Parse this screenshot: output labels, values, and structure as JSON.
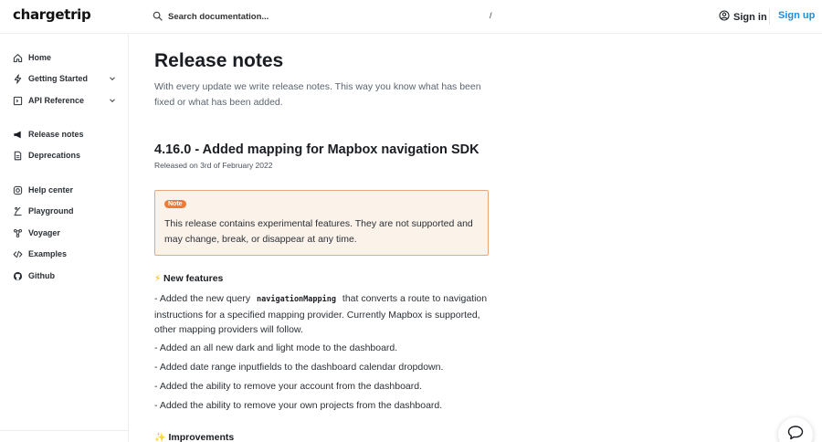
{
  "header": {
    "logo": "chargetrip",
    "search_placeholder": "Search documentation...",
    "search_shortcut": "/",
    "sign_in": "Sign in",
    "sign_up": "Sign up"
  },
  "sidebar": {
    "items": [
      {
        "label": "Home",
        "icon": "home-icon"
      },
      {
        "label": "Getting Started",
        "icon": "lightning-icon"
      },
      {
        "label": "API Reference",
        "icon": "code-file-icon"
      },
      {
        "label": "Release notes",
        "icon": "megaphone-icon"
      },
      {
        "label": "Deprecations",
        "icon": "document-icon"
      },
      {
        "label": "Help center",
        "icon": "lifebuoy-icon"
      },
      {
        "label": "Playground",
        "icon": "slide-icon"
      },
      {
        "label": "Voyager",
        "icon": "network-icon"
      },
      {
        "label": "Examples",
        "icon": "code-brackets-icon"
      },
      {
        "label": "Github",
        "icon": "github-icon"
      }
    ]
  },
  "main": {
    "title": "Release notes",
    "intro": "With every update we write release notes. This way you know what has been fixed or what has been added.",
    "release_title": "4.16.0 - Added mapping for Mapbox navigation SDK",
    "release_date": "Released on 3rd of February 2022",
    "note_badge": "Note",
    "note_text": "This release contains experimental features. They are not supported and may change, break, or disappear at any time.",
    "new_features_title": "New features",
    "new_features_emoji": "⚡",
    "feature1_pre": "- Added the new query",
    "feature1_code": "navigationMapping",
    "feature1_post": "that converts a route to navigation instructions for a specified mapping provider. Currently Mapbox is supported, other mapping providers will follow.",
    "feature2": "- Added an all new dark and light mode to the dashboard.",
    "feature3": "- Added date range inputfields to the dashboard calendar dropdown.",
    "feature4": "- Added the ability to remove your account from the dashboard.",
    "feature5": "- Added the ability to remove your own projects from the dashboard.",
    "improvements_title": "Improvements",
    "improvements_emoji": "✨"
  },
  "colors": {
    "accent": "#1b8ee0",
    "note_bg": "#fbf2ea",
    "note_border": "#e8a77c",
    "badge": "#ee7b33"
  }
}
